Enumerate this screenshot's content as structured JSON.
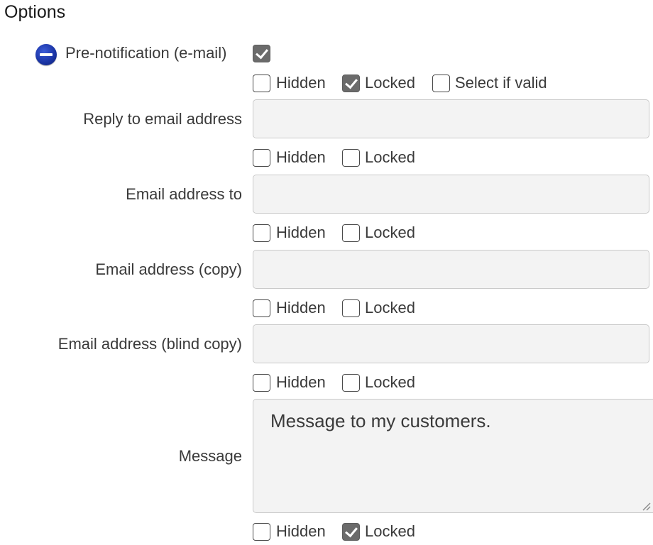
{
  "section": {
    "title": "Options"
  },
  "prenotification": {
    "label": "Pre-notification (e-mail)",
    "checked": true
  },
  "option_labels": {
    "hidden": "Hidden",
    "locked": "Locked",
    "select_if_valid": "Select if valid"
  },
  "prenotification_options": {
    "hidden": false,
    "locked": true,
    "select_if_valid": false
  },
  "fields": {
    "reply_to": {
      "label": "Reply to email address",
      "value": "",
      "hidden": false,
      "locked": false
    },
    "email_to": {
      "label": "Email address to",
      "value": "",
      "hidden": false,
      "locked": false
    },
    "email_copy": {
      "label": "Email address (copy)",
      "value": "",
      "hidden": false,
      "locked": false
    },
    "email_blind_copy": {
      "label": "Email address (blind copy)",
      "value": "",
      "hidden": false,
      "locked": false
    },
    "message": {
      "label": "Message",
      "value": "Message to my customers.",
      "hidden": false,
      "locked": true
    }
  }
}
